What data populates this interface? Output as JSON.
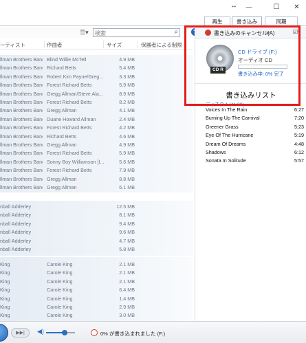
{
  "window": {
    "minimize": "—",
    "maximize": "☐",
    "close": "✕"
  },
  "tabs": {
    "play": "再生",
    "burn": "書き込み",
    "sync": "同期"
  },
  "toolbar": {
    "search_placeholder": "検索"
  },
  "columns": {
    "artist": "ーティスト",
    "composer": "作曲者",
    "size": "サイズ",
    "parental": "保護者による制限"
  },
  "tracks": [
    {
      "artist": "llman Brothers Band",
      "composer": "Blind Willie McTell",
      "size": "4.9 MB"
    },
    {
      "artist": "llman Brothers Band",
      "composer": "Richard Betts",
      "size": "5.4 MB"
    },
    {
      "artist": "llman Brothers Band",
      "composer": "Robert Kim Payne/Greg...",
      "size": "3.3 MB"
    },
    {
      "artist": "llman Brothers Band",
      "composer": "Forest Richard Betts",
      "size": "5.9 MB"
    },
    {
      "artist": "llman Brothers Band",
      "composer": "Gregg Allman/Steve Ala...",
      "size": "8.9 MB"
    },
    {
      "artist": "llman Brothers Band",
      "composer": "Forest Richard Betts",
      "size": "8.2 MB"
    },
    {
      "artist": "llman Brothers Band",
      "composer": "Gregg Allman",
      "size": "4.1 MB"
    },
    {
      "artist": "llman Brothers Band",
      "composer": "Duane Howard Allman",
      "size": "2.4 MB"
    },
    {
      "artist": "llman Brothers Band",
      "composer": "Forest Richard Betts",
      "size": "4.2 MB"
    },
    {
      "artist": "llman Brothers Band",
      "composer": "Richard Betts",
      "size": "4.6 MB"
    },
    {
      "artist": "llman Brothers Band",
      "composer": "Gregg Allman",
      "size": "4.9 MB"
    },
    {
      "artist": "llman Brothers Band",
      "composer": "Forest Richard Betts",
      "size": "5.9 MB"
    },
    {
      "artist": "llman Brothers Band",
      "composer": "Sonny Boy Williamson [I...",
      "size": "5.6 MB"
    },
    {
      "artist": "llman Brothers Band",
      "composer": "Forest Richard Betts",
      "size": "7.9 MB"
    },
    {
      "artist": "llman Brothers Band",
      "composer": "Gregg Allman",
      "size": "8.8 MB"
    },
    {
      "artist": "llman Brothers Band",
      "composer": "Gregg Allman",
      "size": "6.1 MB"
    },
    {
      "artist": "nball Adderley",
      "composer": "",
      "size": "12.5 MB"
    },
    {
      "artist": "nball Adderley",
      "composer": "",
      "size": "8.1 MB"
    },
    {
      "artist": "nball Adderley",
      "composer": "",
      "size": "9.4 MB"
    },
    {
      "artist": "nball Adderley",
      "composer": "",
      "size": "9.6 MB"
    },
    {
      "artist": "nball Adderley",
      "composer": "",
      "size": "4.7 MB"
    },
    {
      "artist": "nball Adderley",
      "composer": "",
      "size": "5.8 MB"
    },
    {
      "artist": "King",
      "composer": "Carole King",
      "size": "2.1 MB"
    },
    {
      "artist": "King",
      "composer": "Carole King",
      "size": "2.1 MB"
    },
    {
      "artist": "King",
      "composer": "Carole King",
      "size": "2.1 MB"
    },
    {
      "artist": "King",
      "composer": "Carole King",
      "size": "6.4 MB"
    },
    {
      "artist": "King",
      "composer": "Carole King",
      "size": "1.4 MB"
    },
    {
      "artist": "King",
      "composer": "Carole King",
      "size": "2.9 MB"
    },
    {
      "artist": "King",
      "composer": "Carole King",
      "size": "3.0 MB"
    }
  ],
  "burn_pane": {
    "cancel_label": "書き込みのキャンセル(A)",
    "more": "»",
    "drive_label": "CD ドライブ (F:)",
    "disc_type": "オーディオ CD",
    "cd_badge": "CD R",
    "progress_fraction": 0.0,
    "status": "書き込み中: 0% 完了",
    "list_title": "書き込みリスト",
    "disc_info": "ディスク 1 (41:30)",
    "items": [
      {
        "title": "Voices In The Rain",
        "duration": "6:27"
      },
      {
        "title": "Burning Up The Carnival",
        "duration": "7:20"
      },
      {
        "title": "Greener Grass",
        "duration": "5:23"
      },
      {
        "title": "Eye Of The Hurricane",
        "duration": "5:19"
      },
      {
        "title": "Dream Of Dreams",
        "duration": "4:48"
      },
      {
        "title": "Shadows",
        "duration": "6:12"
      },
      {
        "title": "Sonata In Solitude",
        "duration": "5:57"
      }
    ]
  },
  "player": {
    "next_icon": "▶▶|",
    "status": "0% が書き込まれました (F:)"
  },
  "colors": {
    "highlight": "#e21b1b",
    "link_blue": "#1d64c7",
    "progress_green": "#3c9c3c"
  }
}
